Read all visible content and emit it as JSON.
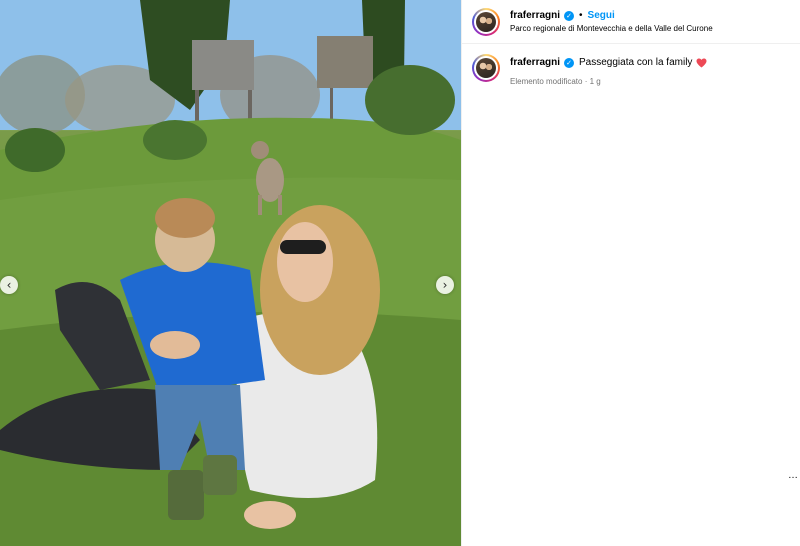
{
  "post": {
    "username": "fraferragni",
    "follow_label": "Segui",
    "separator": "•",
    "location": "Parco regionale di Montevecchia e della Valle del Curone",
    "caption": "Passeggiata con la family",
    "edited_label": "Elemento modificato",
    "time_ago": "1 g",
    "verified_glyph": "✓",
    "caption_emoji": "red-heart"
  },
  "media": {
    "prev_glyph": "‹",
    "next_glyph": "›"
  },
  "more_glyph": "…",
  "colors": {
    "accent_blue": "#0095f6",
    "muted_text": "#737373",
    "divider": "#efefef",
    "heart_red": "#ed4956"
  }
}
